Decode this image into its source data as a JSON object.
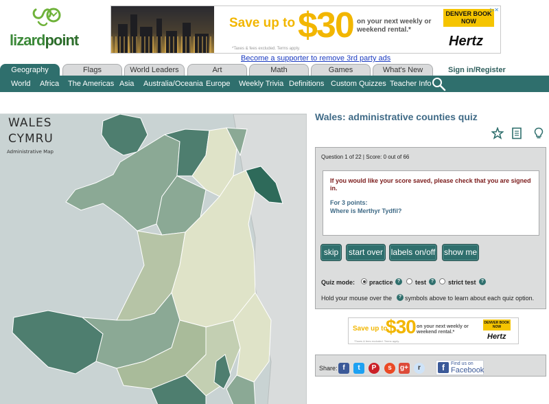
{
  "logo": {
    "text_part1": "lizard",
    "text_part2": "point"
  },
  "ad_banner": {
    "save_text": "Save up to",
    "amount": "$30",
    "subtitle": "on your next weekly or weekend rental.*",
    "fine_print": "*Taxes & fees excluded. Terms apply.",
    "cta": "DENVER BOOK NOW",
    "brand": "Hertz"
  },
  "support_link": "Become a supporter to remove 3rd party ads",
  "tabs": [
    {
      "label": "Geography",
      "active": true
    },
    {
      "label": "Flags",
      "active": false
    },
    {
      "label": "World Leaders",
      "active": false
    },
    {
      "label": "Art",
      "active": false
    },
    {
      "label": "Math",
      "active": false
    },
    {
      "label": "Games",
      "active": false
    },
    {
      "label": "What's New",
      "active": false
    }
  ],
  "signin": "Sign in/Register",
  "subnav": [
    "World",
    "Africa",
    "The Americas",
    "Asia",
    "Australia/Oceania",
    "Europe",
    "Weekly Trivia",
    "Definitions",
    "Custom Quizzes",
    "Teacher Info"
  ],
  "map": {
    "title_line1": "WALES",
    "title_line2": "CYMRU",
    "subtitle": "Administrative Map"
  },
  "quiz": {
    "title": "Wales: administrative counties quiz",
    "status": "Question 1 of 22 | Score: 0 out of 66",
    "warning": "If you would like your score saved, please check that you are signed in.",
    "points": "For 3 points:",
    "question": "Where is Merthyr Tydfil?",
    "buttons": [
      "skip",
      "start over",
      "labels on/off",
      "show me"
    ],
    "mode_label": "Quiz mode:",
    "modes": [
      {
        "label": "practice",
        "selected": true
      },
      {
        "label": "test",
        "selected": false
      },
      {
        "label": "strict test",
        "selected": false
      }
    ],
    "hint_part1": "Hold your mouse over the",
    "hint_part2": "symbols above to learn about each quiz option."
  },
  "ad_banner_small": {
    "save_text": "Save up to",
    "amount": "$30",
    "subtitle": "on your next weekly or weekend rental.*",
    "fine_print": "*Taxes & fees excluded. Terms apply.",
    "cta": "DENVER BOOK NOW",
    "brand": "Hertz"
  },
  "share": {
    "label": "Share:",
    "fb_find": "Find us on",
    "fb_name": "Facebook"
  },
  "colors": {
    "teal": "#2f6f6d",
    "map_dark": "#4e7e6f",
    "map_mid": "#8ba995",
    "map_light": "#c3cfb2",
    "map_pale": "#dfe3c8",
    "sea": "#c9d3d3"
  }
}
